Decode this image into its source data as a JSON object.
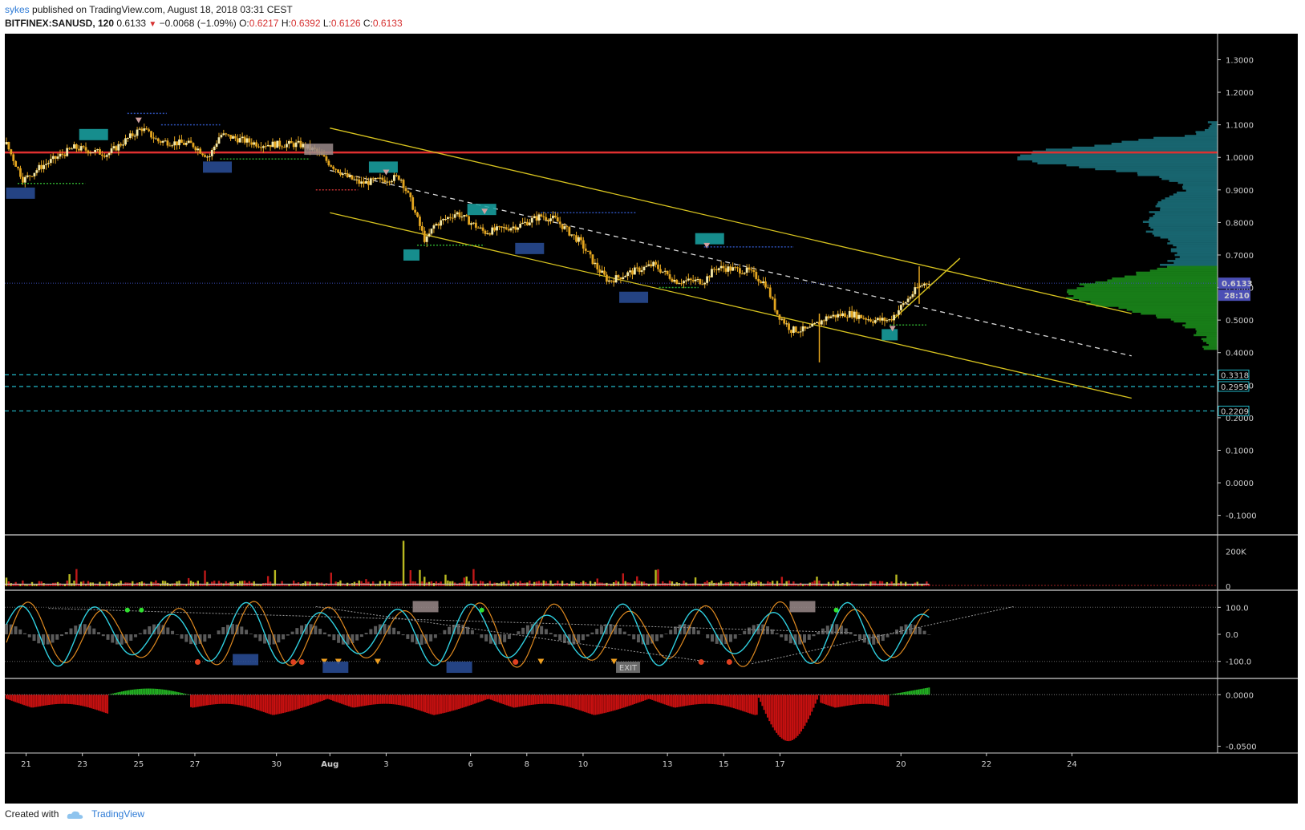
{
  "header": {
    "user": "sykes",
    "published_text": "published on TradingView.com, August 18, 2018 03:31 CEST",
    "symbol": "BITFINEX:SANUSD, 120",
    "last": "0.6133",
    "change": "−0.0068 (−1.09%)",
    "open_label": "O:",
    "open": "0.6217",
    "high_label": "H:",
    "high": "0.6392",
    "low_label": "L:",
    "low": "0.6126",
    "close_label": "C:",
    "close": "0.6133"
  },
  "footer": {
    "created_with": "Created with",
    "brand": "TradingView"
  },
  "colors": {
    "background": "#000000",
    "candle_up": "#f5e9a8",
    "candle_down": "#e3a51f",
    "resistance": "#e03030",
    "channel": "#d6c21f",
    "support_dash": "#22b8c8",
    "volume_profile_top": "#1b6f7a",
    "volume_profile_bottom": "#1b8a1b",
    "osc_fast": "#2fd0e0",
    "osc_slow": "#e08a20",
    "hist_neg": "#c81010",
    "hist_pos": "#22b022"
  },
  "chart_data": {
    "type": "candlestick",
    "symbol": "BITFINEX:SANUSD",
    "interval": "120",
    "x_ticks": [
      "21",
      "23",
      "25",
      "27",
      "30",
      "Aug",
      "3",
      "6",
      "8",
      "10",
      "13",
      "15",
      "17",
      "20",
      "22",
      "24"
    ],
    "y_ticks": [
      "1.3000",
      "1.2000",
      "1.1000",
      "1.0000",
      "0.9000",
      "0.8000",
      "0.7000",
      "0.6000",
      "0.5000",
      "0.4000",
      "0.3000",
      "0.2000",
      "0.1000",
      "0.0000",
      "-0.1000"
    ],
    "ylim": [
      -0.16,
      1.38
    ],
    "price_path": [
      {
        "t": 0,
        "p": 1.04
      },
      {
        "t": 0.6,
        "p": 0.93
      },
      {
        "t": 1.2,
        "p": 0.97
      },
      {
        "t": 2.4,
        "p": 1.03
      },
      {
        "t": 3.6,
        "p": 1.01
      },
      {
        "t": 4.8,
        "p": 1.09
      },
      {
        "t": 5.4,
        "p": 1.05
      },
      {
        "t": 6.6,
        "p": 1.04
      },
      {
        "t": 7.2,
        "p": 1.0
      },
      {
        "t": 7.6,
        "p": 1.07
      },
      {
        "t": 9,
        "p": 1.04
      },
      {
        "t": 10.4,
        "p": 1.04
      },
      {
        "t": 11,
        "p": 1.02
      },
      {
        "t": 11.5,
        "p": 0.98
      },
      {
        "t": 12.1,
        "p": 0.94
      },
      {
        "t": 12.6,
        "p": 0.92
      },
      {
        "t": 13.3,
        "p": 0.93
      },
      {
        "t": 14,
        "p": 0.94
      },
      {
        "t": 14.4,
        "p": 0.86
      },
      {
        "t": 14.9,
        "p": 0.74
      },
      {
        "t": 15.2,
        "p": 0.79
      },
      {
        "t": 16,
        "p": 0.83
      },
      {
        "t": 17,
        "p": 0.77
      },
      {
        "t": 18.2,
        "p": 0.79
      },
      {
        "t": 19,
        "p": 0.82
      },
      {
        "t": 19.5,
        "p": 0.81
      },
      {
        "t": 20,
        "p": 0.77
      },
      {
        "t": 20.4,
        "p": 0.74
      },
      {
        "t": 21,
        "p": 0.66
      },
      {
        "t": 21.4,
        "p": 0.62
      },
      {
        "t": 22.3,
        "p": 0.65
      },
      {
        "t": 23,
        "p": 0.67
      },
      {
        "t": 23.8,
        "p": 0.62
      },
      {
        "t": 24.8,
        "p": 0.62
      },
      {
        "t": 25.2,
        "p": 0.66
      },
      {
        "t": 25.5,
        "p": 0.66
      },
      {
        "t": 26.4,
        "p": 0.65
      },
      {
        "t": 27,
        "p": 0.61
      },
      {
        "t": 27.4,
        "p": 0.52
      },
      {
        "t": 27.9,
        "p": 0.47
      },
      {
        "t": 28.5,
        "p": 0.47
      },
      {
        "t": 29.2,
        "p": 0.51
      },
      {
        "t": 30,
        "p": 0.52
      },
      {
        "t": 30.8,
        "p": 0.5
      },
      {
        "t": 31.4,
        "p": 0.5
      },
      {
        "t": 32,
        "p": 0.56
      },
      {
        "t": 32.4,
        "p": 0.6
      },
      {
        "t": 32.8,
        "p": 0.62
      }
    ],
    "resistance_line": 1.015,
    "last_price": 0.6133,
    "last_price_label": "0.6133",
    "countdown": "28:10",
    "support_levels": [
      {
        "value": 0.3318,
        "label": "0.3318"
      },
      {
        "value": 0.2959,
        "label": "0.2959"
      },
      {
        "value": 0.2209,
        "label": "0.2209"
      }
    ],
    "channel_upper": [
      {
        "t": 11.5,
        "p": 1.09
      },
      {
        "t": 40,
        "p": 0.52
      }
    ],
    "channel_mid": [
      {
        "t": 11.5,
        "p": 0.96
      },
      {
        "t": 40,
        "p": 0.39
      }
    ],
    "channel_lower": [
      {
        "t": 11.5,
        "p": 0.83
      },
      {
        "t": 40,
        "p": 0.26
      }
    ],
    "short_trend": [
      {
        "t": 31.5,
        "p": 0.5
      },
      {
        "t": 33.9,
        "p": 0.69
      }
    ],
    "volume": {
      "ticks": [
        "200K",
        "0"
      ],
      "ylim": [
        0,
        280000
      ],
      "spike": 260000
    },
    "oscillator": {
      "ticks": [
        "100.0",
        "0.0",
        "-100.0"
      ],
      "ylim": [
        -125,
        125
      ],
      "exit_label": "EXIT"
    },
    "histogram": {
      "ticks": [
        "0.0000",
        "-0.0500"
      ],
      "ylim": [
        -0.055,
        0.015
      ]
    }
  }
}
